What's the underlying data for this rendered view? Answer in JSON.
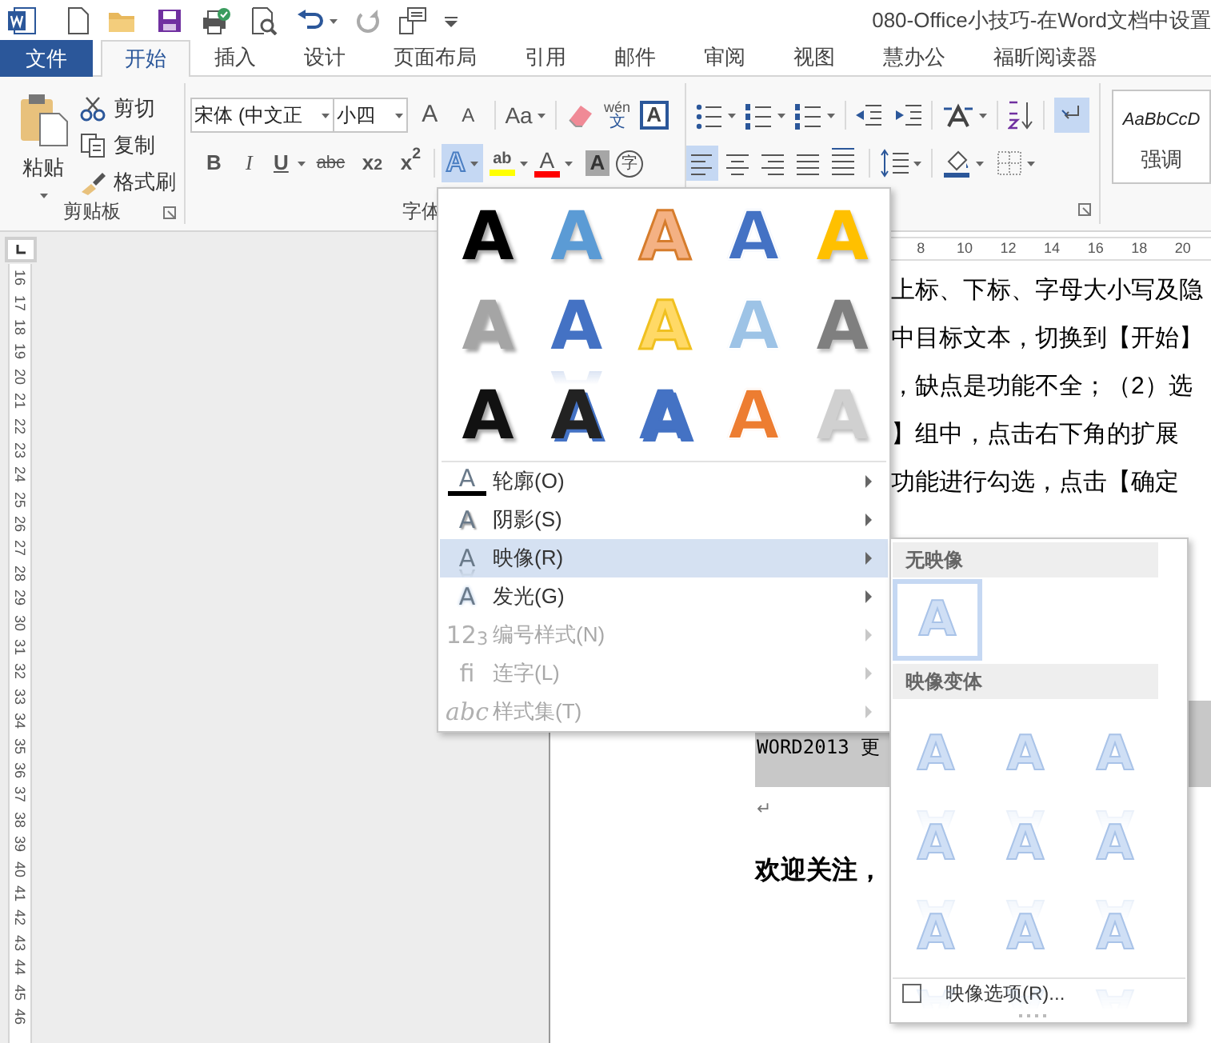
{
  "title": "080-Office小技巧-在Word文档中设置",
  "tabs": [
    {
      "label": "文件",
      "kind": "file",
      "selected": false
    },
    {
      "label": "开始",
      "kind": "tab",
      "selected": true
    },
    {
      "label": "插入",
      "kind": "tab",
      "selected": false
    },
    {
      "label": "设计",
      "kind": "tab",
      "selected": false
    },
    {
      "label": "页面布局",
      "kind": "tab",
      "selected": false
    },
    {
      "label": "引用",
      "kind": "tab",
      "selected": false
    },
    {
      "label": "邮件",
      "kind": "tab",
      "selected": false
    },
    {
      "label": "审阅",
      "kind": "tab",
      "selected": false
    },
    {
      "label": "视图",
      "kind": "tab",
      "selected": false
    },
    {
      "label": "慧办公",
      "kind": "tab",
      "selected": false
    },
    {
      "label": "福昕阅读器",
      "kind": "tab",
      "selected": false
    }
  ],
  "clipboard": {
    "label": "剪贴板",
    "paste": "粘贴",
    "cut": "剪切",
    "copy": "复制",
    "format_painter": "格式刷"
  },
  "font": {
    "label": "字体",
    "font_name": "宋体 (中文正",
    "font_size": "小四",
    "grow": "A",
    "shrink": "A",
    "change_case": "Aa",
    "phonetic": "wén",
    "phonetic_char": "文",
    "border_char": "A",
    "bold": "B",
    "italic": "I",
    "underline": "U",
    "strikethrough": "abc",
    "subscript": "x$_{2}$",
    "superscript": "x$^{2}$",
    "text_effects": {
      "label": "A",
      "selected": true
    },
    "highlight": "ab",
    "font_color": "A",
    "shading": "A",
    "enclosed": "字"
  },
  "paragraph": {
    "alignment": [
      {
        "kind": "left",
        "selected": true
      },
      {
        "kind": "center",
        "selected": false
      },
      {
        "kind": "right",
        "selected": false
      },
      {
        "kind": "justify",
        "selected": false
      },
      {
        "kind": "distributed",
        "selected": false
      }
    ],
    "show_marks": {
      "on": true
    }
  },
  "styles": {
    "preview": "AaBbCcD",
    "label": "强调"
  },
  "text_effects_menu": {
    "gallery": [
      {
        "label": "A",
        "kind": "shadow",
        "color": "#000000"
      },
      {
        "label": "A",
        "kind": "gradient",
        "color": "#5b9bd5"
      },
      {
        "label": "A",
        "kind": "filled-outline",
        "color": "#f4b183"
      },
      {
        "label": "A",
        "kind": "outline",
        "color": "#4472c4"
      },
      {
        "label": "A",
        "kind": "gradient",
        "color": "#ffc000"
      },
      {
        "label": "A",
        "kind": "shadow",
        "color": "#a5a5a5"
      },
      {
        "label": "A",
        "kind": "reflection",
        "color": "#4472c4"
      },
      {
        "label": "A",
        "kind": "filled-outline",
        "color": "#ffd966"
      },
      {
        "label": "A",
        "kind": "outline",
        "color": "#9dc3e6"
      },
      {
        "label": "A",
        "kind": "gradient",
        "color": "#7f7f7f"
      },
      {
        "label": "A",
        "kind": "shadow",
        "color": "#111111"
      },
      {
        "label": "A",
        "kind": "offset",
        "color": "#222222"
      },
      {
        "label": "A",
        "kind": "offset",
        "color": "#4472c4"
      },
      {
        "label": "A",
        "kind": "outline",
        "color": "#ed7d31"
      },
      {
        "label": "A",
        "kind": "gradient",
        "color": "#d0d0d0"
      }
    ],
    "items": [
      {
        "icon": "A",
        "kind": "outline",
        "label": "轮廓(O)",
        "selected": false,
        "disabled": false
      },
      {
        "icon": "A",
        "kind": "shadow",
        "label": "阴影(S)",
        "selected": false,
        "disabled": false
      },
      {
        "icon": "A",
        "kind": "reflection",
        "label": "映像(R)",
        "selected": true,
        "disabled": false
      },
      {
        "icon": "A",
        "kind": "glow",
        "label": "发光(G)",
        "selected": false,
        "disabled": false
      },
      {
        "icon": "12$_{3}$",
        "kind": "number",
        "label": "编号样式(N)",
        "selected": false,
        "disabled": true
      },
      {
        "icon": "fi",
        "kind": "ligature",
        "label": "连字(L)",
        "selected": false,
        "disabled": true
      },
      {
        "icon": "abc",
        "kind": "styleset",
        "label": "样式集(T)",
        "selected": false,
        "disabled": true
      }
    ]
  },
  "reflection_submenu": {
    "none_header": "无映像",
    "none_option": {
      "label": "A",
      "selected": true
    },
    "variants_header": "映像变体",
    "variants": [
      {
        "label": "A",
        "selected": false
      },
      {
        "label": "A",
        "selected": false
      },
      {
        "label": "A",
        "selected": false
      },
      {
        "label": "A",
        "selected": false
      },
      {
        "label": "A",
        "selected": false
      },
      {
        "label": "A",
        "selected": false
      },
      {
        "label": "A",
        "selected": false
      },
      {
        "label": "A",
        "selected": false
      },
      {
        "label": "A",
        "selected": false
      }
    ],
    "options": {
      "label": "映像选项(R)...",
      "checked": false
    }
  },
  "ruler": {
    "horizontal": [
      "8",
      "10",
      "12",
      "14",
      "16",
      "18",
      "20"
    ],
    "vertical": [
      "16",
      "17",
      "18",
      "19",
      "20",
      "21",
      "22",
      "23",
      "24",
      "25",
      "26",
      "27",
      "28",
      "29",
      "30",
      "31",
      "32",
      "33",
      "34",
      "35",
      "36",
      "37",
      "38",
      "39",
      "40",
      "41",
      "42",
      "43",
      "44",
      "45",
      "46"
    ]
  },
  "document": {
    "lines": [
      "上标、下标、字母大小写及隐",
      "中目标文本，切换到【开始】",
      "，缺点是功能不全；（2）选",
      "】组中，点击右下角的扩展",
      "功能进行勾选，点击【确定"
    ],
    "code_block": "WORD2013 更",
    "paragraph_mark": "↵",
    "footer": "欢迎关注，"
  }
}
